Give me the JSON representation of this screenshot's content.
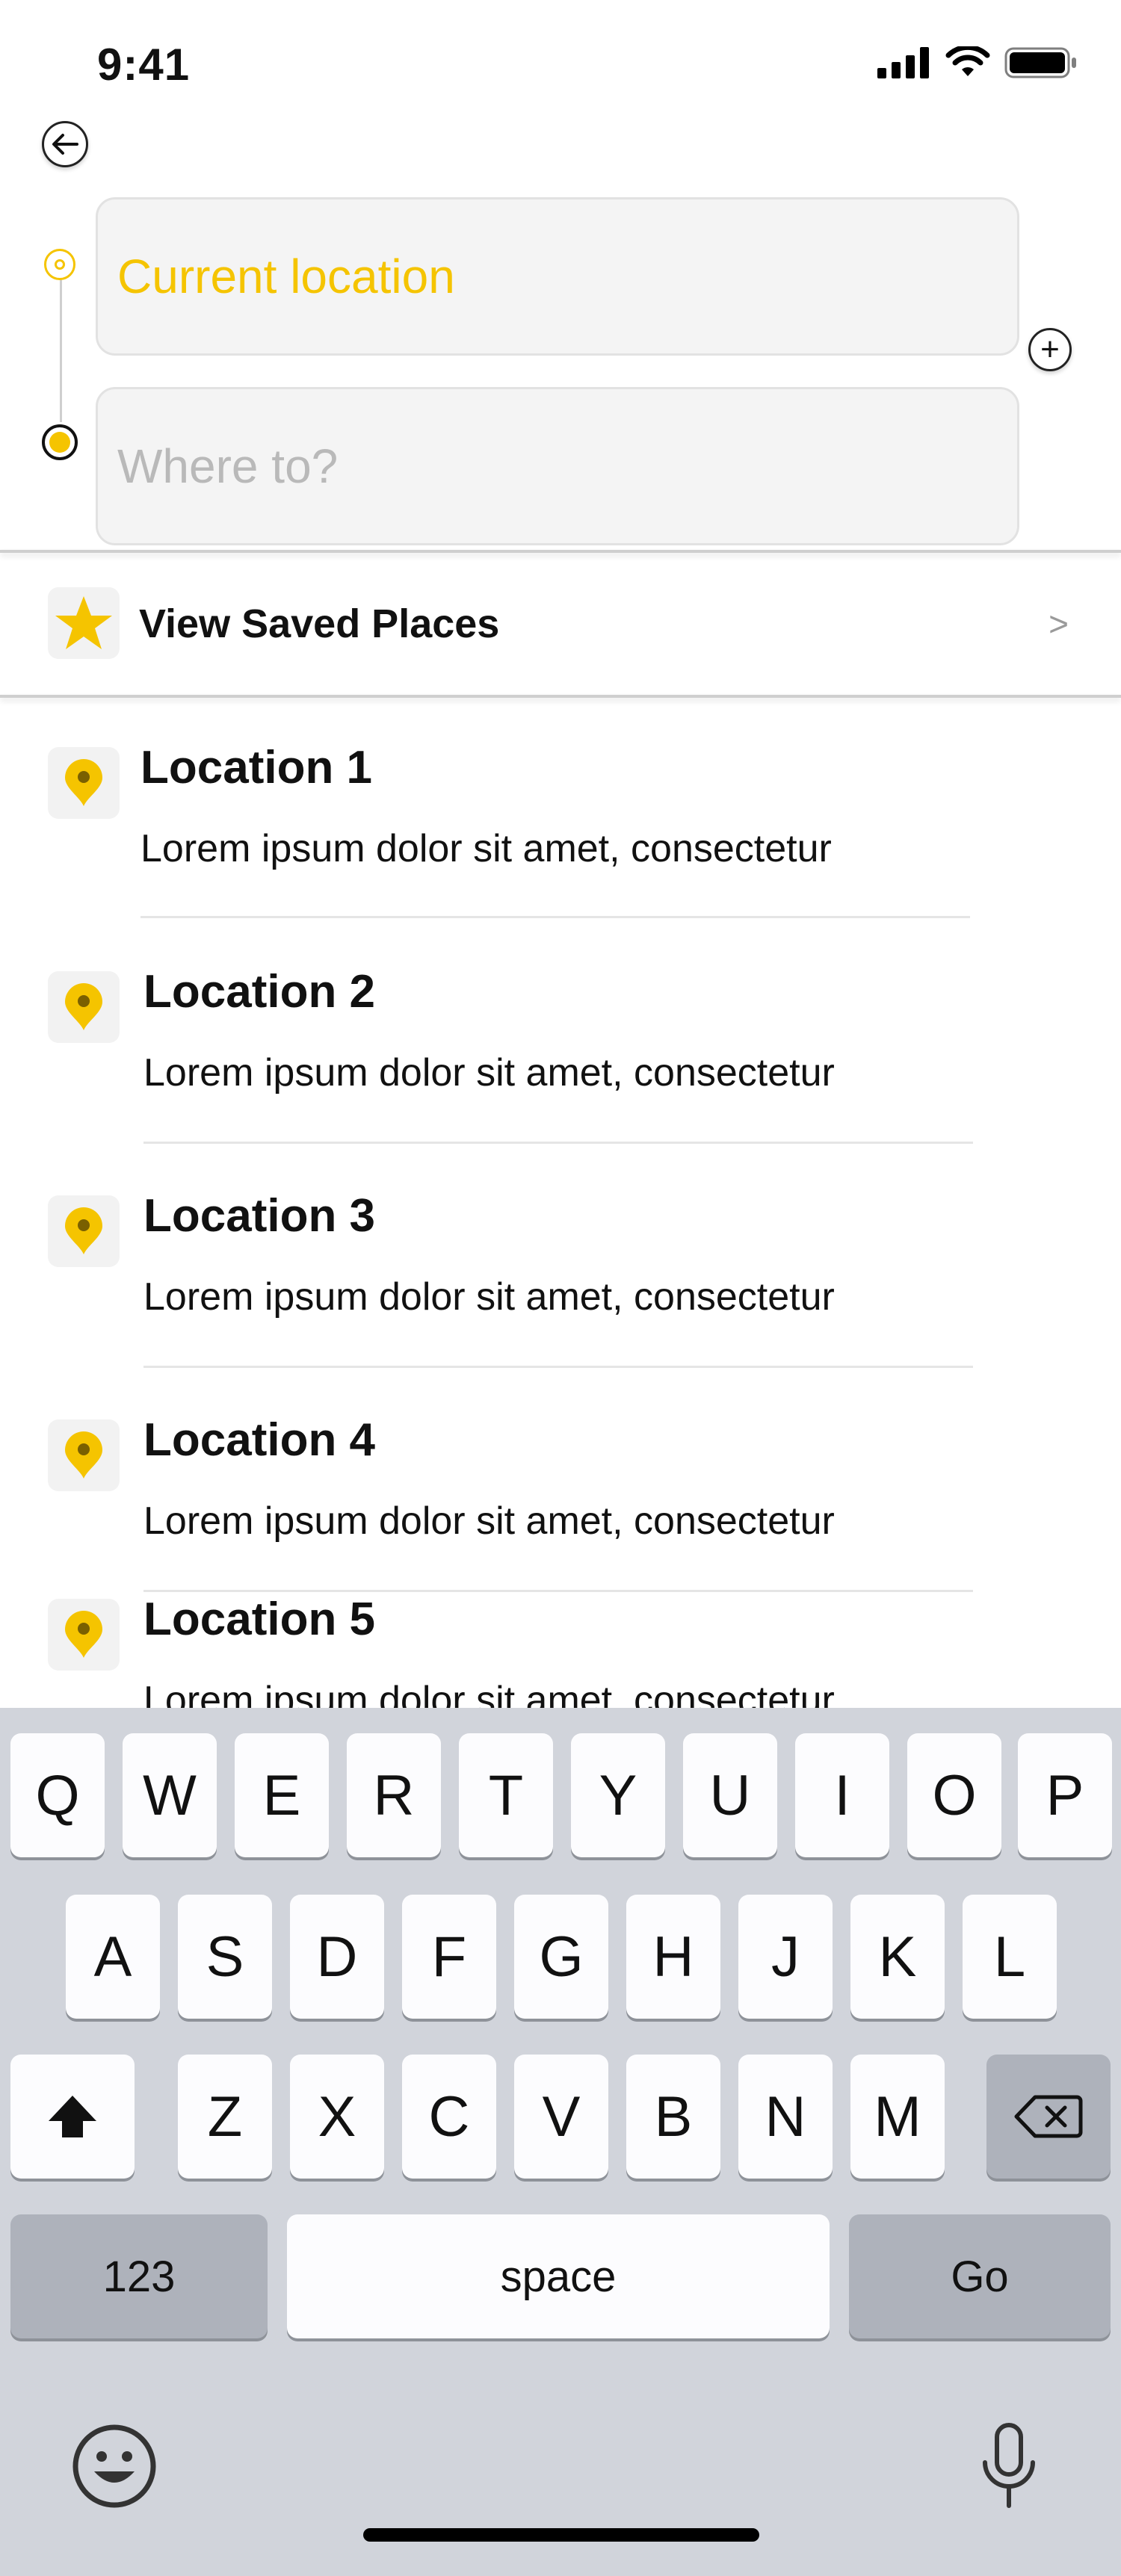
{
  "status_bar": {
    "time": "9:41"
  },
  "route": {
    "origin_value": "Current location",
    "destination_placeholder": "Where to?",
    "add_stop_symbol": "+"
  },
  "saved_places": {
    "label": "View Saved Places",
    "chevron": ">"
  },
  "locations": [
    {
      "title": "Location 1",
      "subtitle": "Lorem ipsum dolor sit amet, consectetur"
    },
    {
      "title": "Location 2",
      "subtitle": "Lorem ipsum dolor sit amet, consectetur"
    },
    {
      "title": "Location 3",
      "subtitle": "Lorem ipsum dolor sit amet, consectetur"
    },
    {
      "title": "Location 4",
      "subtitle": "Lorem ipsum dolor sit amet, consectetur"
    },
    {
      "title": "Location 5",
      "subtitle": "Lorem ipsum dolor sit amet, consectetur"
    }
  ],
  "keyboard": {
    "row1": [
      "Q",
      "W",
      "E",
      "R",
      "T",
      "Y",
      "U",
      "I",
      "O",
      "P"
    ],
    "row2": [
      "A",
      "S",
      "D",
      "F",
      "G",
      "H",
      "J",
      "K",
      "L"
    ],
    "row3": [
      "Z",
      "X",
      "C",
      "V",
      "B",
      "N",
      "M"
    ],
    "numbers_key": "123",
    "space_key": "space",
    "go_key": "Go"
  },
  "colors": {
    "accent": "#f5c400",
    "keyboard_bg": "#d1d4db"
  }
}
